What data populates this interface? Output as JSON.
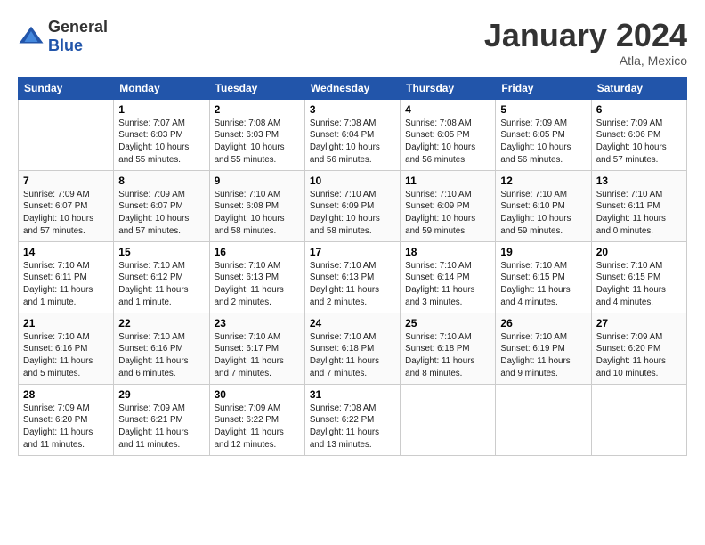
{
  "logo": {
    "general": "General",
    "blue": "Blue"
  },
  "header": {
    "title": "January 2024",
    "location": "Atla, Mexico"
  },
  "weekdays": [
    "Sunday",
    "Monday",
    "Tuesday",
    "Wednesday",
    "Thursday",
    "Friday",
    "Saturday"
  ],
  "weeks": [
    [
      {
        "day": "",
        "info": ""
      },
      {
        "day": "1",
        "info": "Sunrise: 7:07 AM\nSunset: 6:03 PM\nDaylight: 10 hours\nand 55 minutes."
      },
      {
        "day": "2",
        "info": "Sunrise: 7:08 AM\nSunset: 6:03 PM\nDaylight: 10 hours\nand 55 minutes."
      },
      {
        "day": "3",
        "info": "Sunrise: 7:08 AM\nSunset: 6:04 PM\nDaylight: 10 hours\nand 56 minutes."
      },
      {
        "day": "4",
        "info": "Sunrise: 7:08 AM\nSunset: 6:05 PM\nDaylight: 10 hours\nand 56 minutes."
      },
      {
        "day": "5",
        "info": "Sunrise: 7:09 AM\nSunset: 6:05 PM\nDaylight: 10 hours\nand 56 minutes."
      },
      {
        "day": "6",
        "info": "Sunrise: 7:09 AM\nSunset: 6:06 PM\nDaylight: 10 hours\nand 57 minutes."
      }
    ],
    [
      {
        "day": "7",
        "info": "Sunrise: 7:09 AM\nSunset: 6:07 PM\nDaylight: 10 hours\nand 57 minutes."
      },
      {
        "day": "8",
        "info": "Sunrise: 7:09 AM\nSunset: 6:07 PM\nDaylight: 10 hours\nand 57 minutes."
      },
      {
        "day": "9",
        "info": "Sunrise: 7:10 AM\nSunset: 6:08 PM\nDaylight: 10 hours\nand 58 minutes."
      },
      {
        "day": "10",
        "info": "Sunrise: 7:10 AM\nSunset: 6:09 PM\nDaylight: 10 hours\nand 58 minutes."
      },
      {
        "day": "11",
        "info": "Sunrise: 7:10 AM\nSunset: 6:09 PM\nDaylight: 10 hours\nand 59 minutes."
      },
      {
        "day": "12",
        "info": "Sunrise: 7:10 AM\nSunset: 6:10 PM\nDaylight: 10 hours\nand 59 minutes."
      },
      {
        "day": "13",
        "info": "Sunrise: 7:10 AM\nSunset: 6:11 PM\nDaylight: 11 hours\nand 0 minutes."
      }
    ],
    [
      {
        "day": "14",
        "info": "Sunrise: 7:10 AM\nSunset: 6:11 PM\nDaylight: 11 hours\nand 1 minute."
      },
      {
        "day": "15",
        "info": "Sunrise: 7:10 AM\nSunset: 6:12 PM\nDaylight: 11 hours\nand 1 minute."
      },
      {
        "day": "16",
        "info": "Sunrise: 7:10 AM\nSunset: 6:13 PM\nDaylight: 11 hours\nand 2 minutes."
      },
      {
        "day": "17",
        "info": "Sunrise: 7:10 AM\nSunset: 6:13 PM\nDaylight: 11 hours\nand 2 minutes."
      },
      {
        "day": "18",
        "info": "Sunrise: 7:10 AM\nSunset: 6:14 PM\nDaylight: 11 hours\nand 3 minutes."
      },
      {
        "day": "19",
        "info": "Sunrise: 7:10 AM\nSunset: 6:15 PM\nDaylight: 11 hours\nand 4 minutes."
      },
      {
        "day": "20",
        "info": "Sunrise: 7:10 AM\nSunset: 6:15 PM\nDaylight: 11 hours\nand 4 minutes."
      }
    ],
    [
      {
        "day": "21",
        "info": "Sunrise: 7:10 AM\nSunset: 6:16 PM\nDaylight: 11 hours\nand 5 minutes."
      },
      {
        "day": "22",
        "info": "Sunrise: 7:10 AM\nSunset: 6:16 PM\nDaylight: 11 hours\nand 6 minutes."
      },
      {
        "day": "23",
        "info": "Sunrise: 7:10 AM\nSunset: 6:17 PM\nDaylight: 11 hours\nand 7 minutes."
      },
      {
        "day": "24",
        "info": "Sunrise: 7:10 AM\nSunset: 6:18 PM\nDaylight: 11 hours\nand 7 minutes."
      },
      {
        "day": "25",
        "info": "Sunrise: 7:10 AM\nSunset: 6:18 PM\nDaylight: 11 hours\nand 8 minutes."
      },
      {
        "day": "26",
        "info": "Sunrise: 7:10 AM\nSunset: 6:19 PM\nDaylight: 11 hours\nand 9 minutes."
      },
      {
        "day": "27",
        "info": "Sunrise: 7:09 AM\nSunset: 6:20 PM\nDaylight: 11 hours\nand 10 minutes."
      }
    ],
    [
      {
        "day": "28",
        "info": "Sunrise: 7:09 AM\nSunset: 6:20 PM\nDaylight: 11 hours\nand 11 minutes."
      },
      {
        "day": "29",
        "info": "Sunrise: 7:09 AM\nSunset: 6:21 PM\nDaylight: 11 hours\nand 11 minutes."
      },
      {
        "day": "30",
        "info": "Sunrise: 7:09 AM\nSunset: 6:22 PM\nDaylight: 11 hours\nand 12 minutes."
      },
      {
        "day": "31",
        "info": "Sunrise: 7:08 AM\nSunset: 6:22 PM\nDaylight: 11 hours\nand 13 minutes."
      },
      {
        "day": "",
        "info": ""
      },
      {
        "day": "",
        "info": ""
      },
      {
        "day": "",
        "info": ""
      }
    ]
  ]
}
